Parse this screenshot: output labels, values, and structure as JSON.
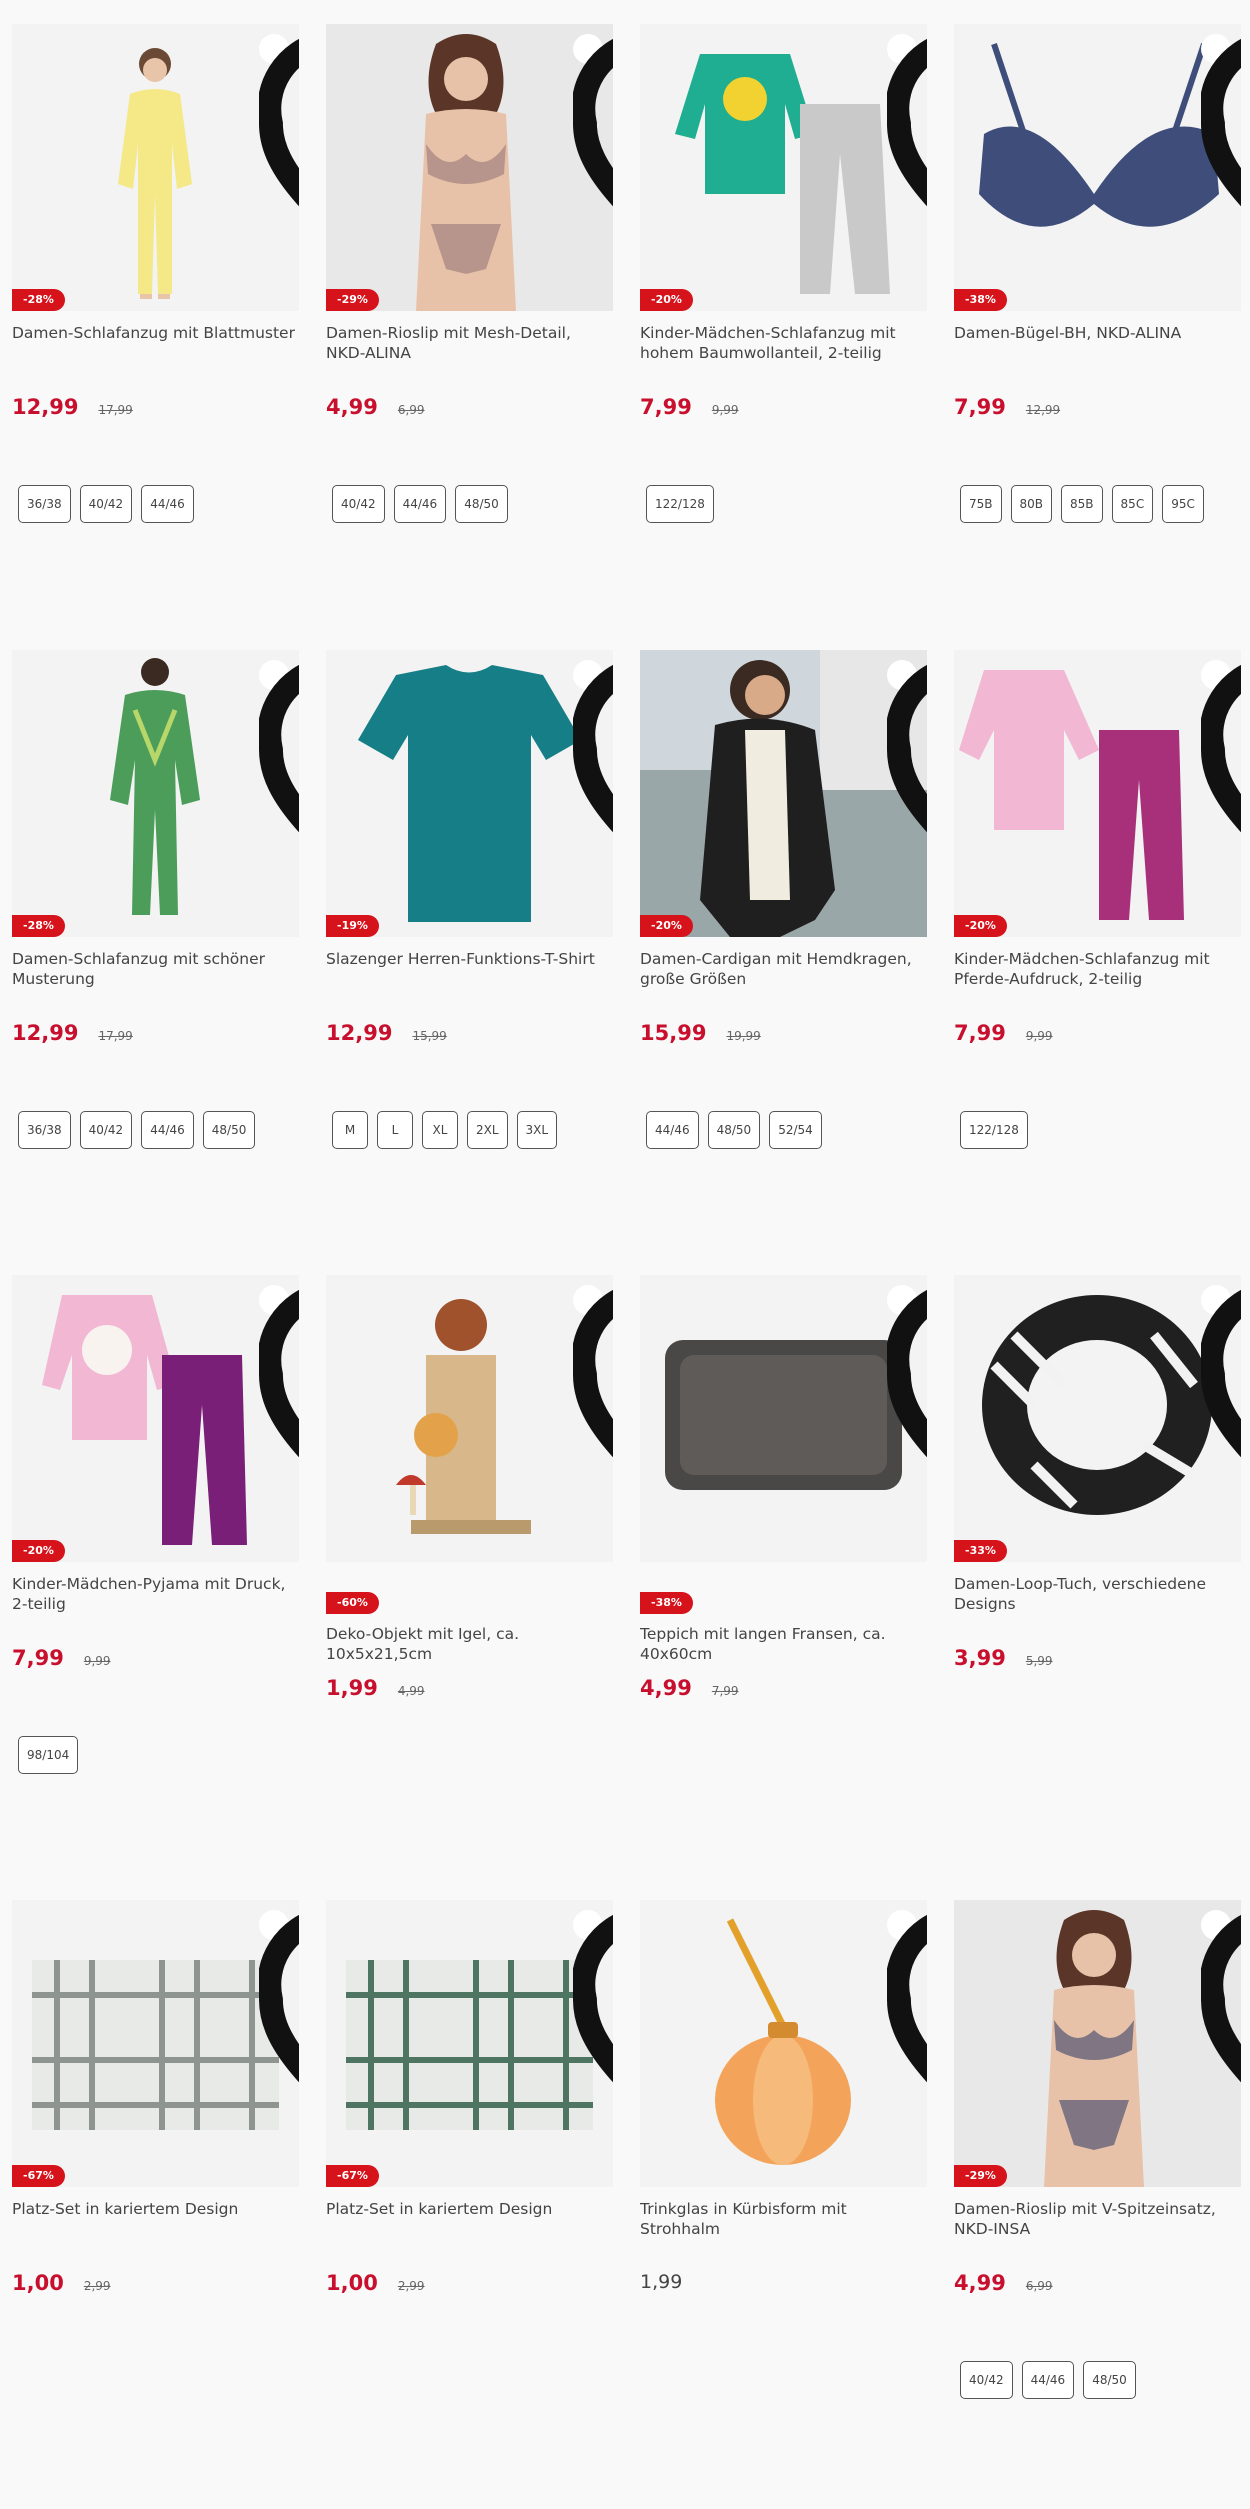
{
  "products": [
    {
      "title": "Damen-Schlafanzug mit Blattmuster",
      "discount": "-28%",
      "price": "12,99",
      "old_price": "17,99",
      "sizes": [
        "36/38",
        "40/42",
        "44/46"
      ]
    },
    {
      "title": "Damen-Rioslip mit Mesh-Detail, NKD-ALINA",
      "discount": "-29%",
      "price": "4,99",
      "old_price": "6,99",
      "sizes": [
        "40/42",
        "44/46",
        "48/50"
      ]
    },
    {
      "title": "Kinder-Mädchen-Schlafanzug mit hohem Baumwollanteil, 2-teilig",
      "discount": "-20%",
      "price": "7,99",
      "old_price": "9,99",
      "sizes": [
        "122/128"
      ]
    },
    {
      "title": "Damen-Bügel-BH, NKD-ALINA",
      "discount": "-38%",
      "price": "7,99",
      "old_price": "12,99",
      "sizes": [
        "75B",
        "80B",
        "85B",
        "85C",
        "95C"
      ]
    },
    {
      "title": "Damen-Schlafanzug mit schöner Musterung",
      "discount": "-28%",
      "price": "12,99",
      "old_price": "17,99",
      "sizes": [
        "36/38",
        "40/42",
        "44/46",
        "48/50"
      ]
    },
    {
      "title": "Slazenger Herren-Funktions-T-Shirt",
      "discount": "-19%",
      "price": "12,99",
      "old_price": "15,99",
      "sizes": [
        "M",
        "L",
        "XL",
        "2XL",
        "3XL"
      ]
    },
    {
      "title": "Damen-Cardigan mit Hemdkragen, große Größen",
      "discount": "-20%",
      "price": "15,99",
      "old_price": "19,99",
      "sizes": [
        "44/46",
        "48/50",
        "52/54"
      ]
    },
    {
      "title": "Kinder-Mädchen-Schlafanzug mit Pferde-Aufdruck, 2-teilig",
      "discount": "-20%",
      "price": "7,99",
      "old_price": "9,99",
      "sizes": [
        "122/128"
      ]
    },
    {
      "title": "Kinder-Mädchen-Pyjama mit Druck, 2-teilig",
      "discount": "-20%",
      "price": "7,99",
      "old_price": "9,99",
      "sizes": [
        "98/104"
      ]
    },
    {
      "title": "Deko-Objekt mit Igel, ca. 10x5x21,5cm",
      "discount": "-60%",
      "price": "1,99",
      "old_price": "4,99",
      "sizes": []
    },
    {
      "title": "Teppich mit langen Fransen, ca. 40x60cm",
      "discount": "-38%",
      "price": "4,99",
      "old_price": "7,99",
      "sizes": []
    },
    {
      "title": "Damen-Loop-Tuch, verschiedene Designs",
      "discount": "-33%",
      "price": "3,99",
      "old_price": "5,99",
      "sizes": []
    },
    {
      "title": "Platz-Set in kariertem Design",
      "discount": "-67%",
      "price": "1,00",
      "old_price": "2,99",
      "sizes": []
    },
    {
      "title": "Platz-Set in kariertem Design",
      "discount": "-67%",
      "price": "1,00",
      "old_price": "2,99",
      "sizes": []
    },
    {
      "title": "Trinkglas in Kürbisform mit Strohhalm",
      "discount": "",
      "price": "1,99",
      "old_price": "",
      "sizes": []
    },
    {
      "title": "Damen-Rioslip mit V-Spitzeinsatz, NKD-INSA",
      "discount": "-29%",
      "price": "4,99",
      "old_price": "6,99",
      "sizes": [
        "40/42",
        "44/46",
        "48/50"
      ]
    }
  ],
  "colors": {
    "sale_red": "#d6131b",
    "price_red": "#c8102e",
    "background": "#f9f9f9"
  },
  "icons": {
    "wishlist": "heart-icon"
  }
}
